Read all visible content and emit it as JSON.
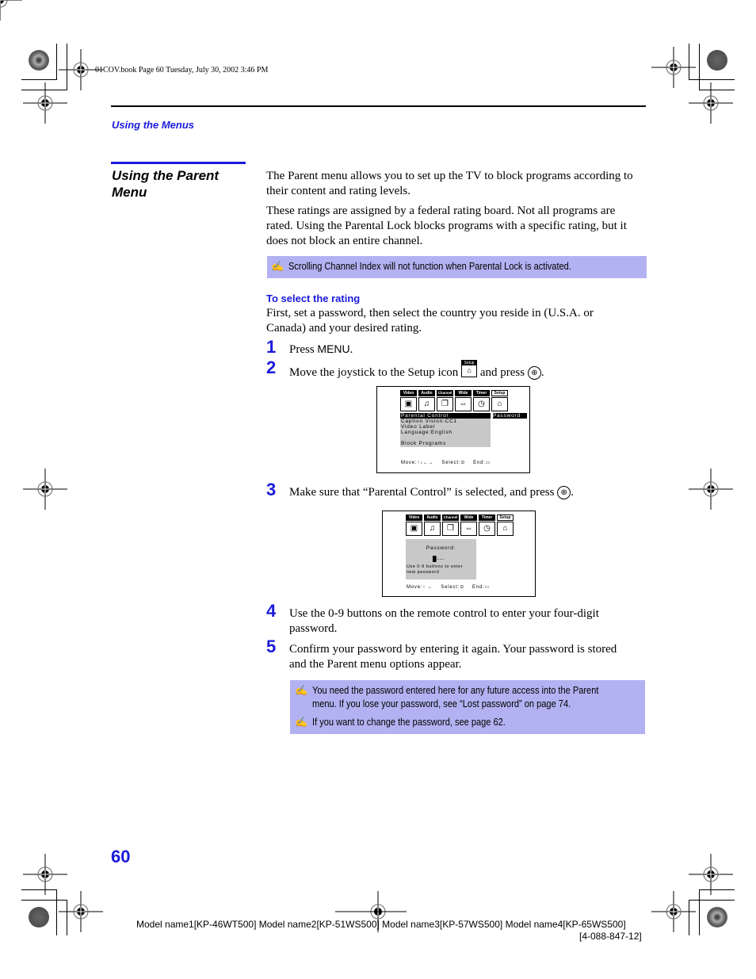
{
  "print_header": {
    "meta": "01COV.book  Page 60  Tuesday, July 30, 2002  3:46 PM"
  },
  "running_head": "Using the Menus",
  "section": {
    "title_line1": "Using the Parent",
    "title_line2": "Menu"
  },
  "intro": {
    "p1_line1": "The Parent menu allows you to set up the TV to block programs according to",
    "p1_line2": "their content and rating levels.",
    "p2_line1": "These ratings are assigned by a federal rating board. Not all programs are",
    "p2_line2": "rated. Using the Parental Lock blocks programs with a specific rating, but it",
    "p2_line3": "does not block an entire channel."
  },
  "note1": {
    "icon": "pencil-note-icon",
    "text": "Scrolling Channel Index will not function when Parental Lock is activated."
  },
  "subsection": {
    "heading": "To select the rating",
    "line1": "First, set a password, then select the country you reside in (U.S.A. or",
    "line2": "Canada) and your desired rating."
  },
  "steps": [
    {
      "num": "1",
      "text_before": "Press ",
      "key": "MENU",
      "text_after": "."
    },
    {
      "num": "2",
      "text_before": "Move the joystick to the Setup icon",
      "text_mid": "and press",
      "text_after": "."
    },
    {
      "num": "3",
      "text_before": "Make sure that “Parental Control” is selected, and press",
      "text_after": "."
    },
    {
      "num": "4",
      "line1": "Use the 0-9 buttons on the remote control to enter your four-digit",
      "line2": "password."
    },
    {
      "num": "5",
      "line1": "Confirm your password by entering it again. Your password is stored",
      "line2": "and the Parent menu options appear."
    }
  ],
  "setup_icon": {
    "label": "Setup",
    "glyph": "✍"
  },
  "joystick_glyph": "⊕",
  "tv_screen1": {
    "tabs": [
      "Video",
      "Audio",
      "Channel",
      "Wide",
      "Timer",
      "Setup"
    ],
    "selected_tab": "Setup",
    "menu_items": [
      "Parental Control",
      "Caption Vision:CC1",
      "Video Label",
      "Language:English",
      "",
      "Block Programs"
    ],
    "selected_item": "Parental Control",
    "side_label": "Password",
    "footer": {
      "move": "Move:↑↓←→",
      "select": "Select:⊙",
      "end": "End:▭"
    }
  },
  "tv_screen2": {
    "tabs": [
      "Video",
      "Audio",
      "Channel",
      "Wide",
      "Timer",
      "Setup"
    ],
    "selected_tab": "Setup",
    "password_label": "Password:",
    "password_value": "█---",
    "hint_line1": "Use 0-9 buttons to enter",
    "hint_line2": "new password",
    "footer": {
      "move": "Move:↑  ←",
      "select": "Select:⊙",
      "end": "End:▭"
    }
  },
  "note2": {
    "items": [
      {
        "line1": "You need the password entered here for any future access into the Parent",
        "line2": "menu. If you lose your password, see “Lost password” on page 74."
      },
      {
        "line1": "If you want to change the password, see page 62."
      }
    ]
  },
  "page_number": "60",
  "footer": {
    "models": "Model name1[KP-46WT500] Model name2[KP-51WS500] Model name3[KP-57WS500] Model name4[KP-65WS500]",
    "part_number": "[4-088-847-12]"
  },
  "colors": {
    "accent_blue": "#1a1adb",
    "note_bg": "#b2b2f2",
    "menu_gray": "#c8c8c8"
  }
}
